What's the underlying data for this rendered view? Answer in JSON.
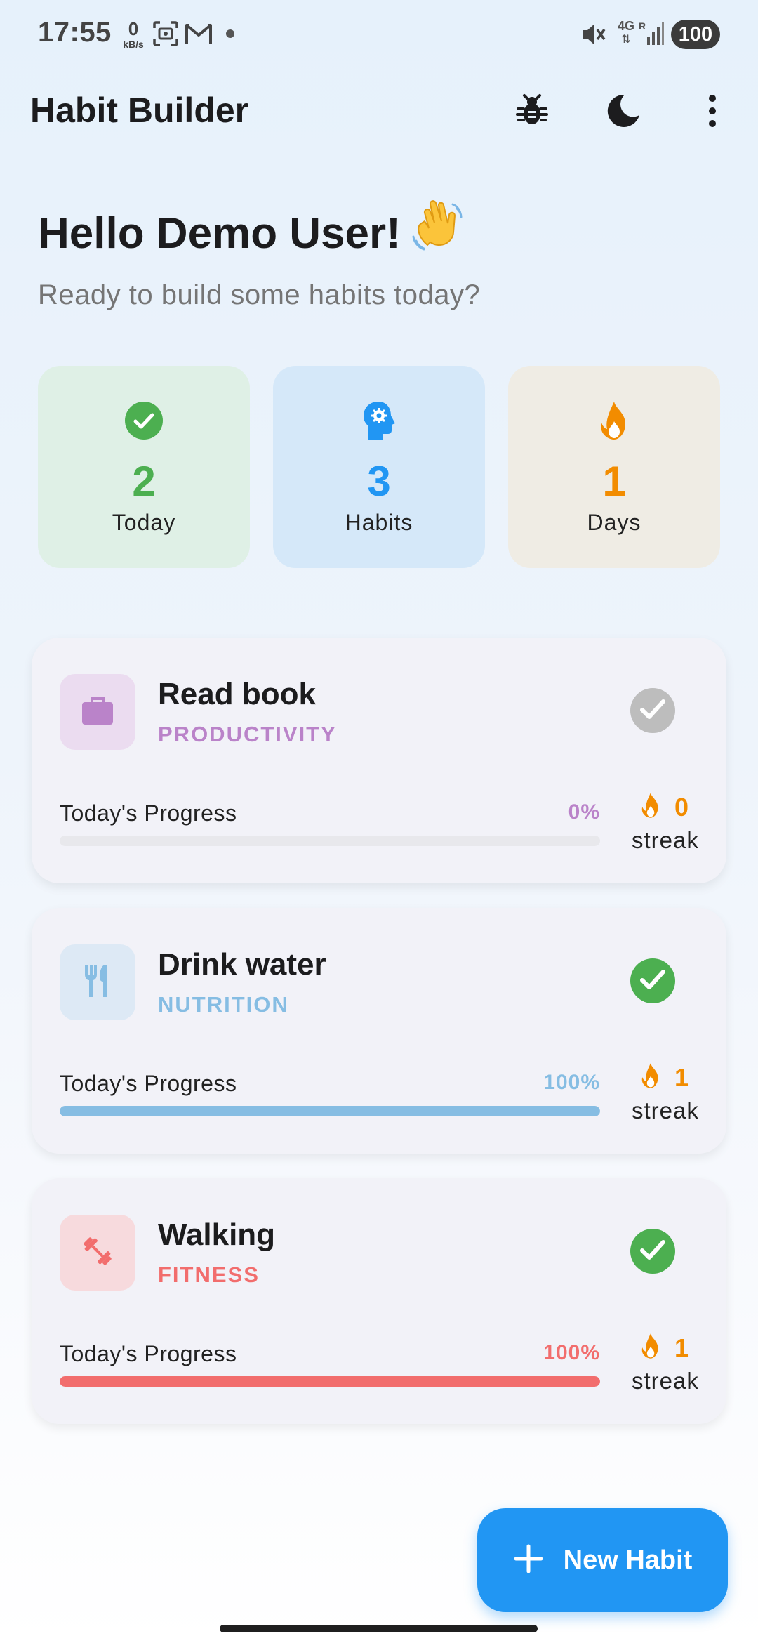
{
  "status_bar": {
    "time": "17:55",
    "speed_value": "0",
    "speed_unit": "kB/s",
    "network": "4G",
    "battery": "100",
    "icons": [
      "screenshot-icon",
      "gmail-icon",
      "mute-icon",
      "signal-icon"
    ]
  },
  "app_bar": {
    "title": "Habit Builder",
    "actions": [
      "bug-icon",
      "dark-mode-icon",
      "more-vert-icon"
    ]
  },
  "greeting": {
    "text": "Hello Demo User!",
    "emoji": "👋",
    "subtitle": "Ready to build some habits today?"
  },
  "stats": [
    {
      "value": "2",
      "label": "Today",
      "icon": "check-circle-icon",
      "color": "#4caf50",
      "bg": "#dff0e6"
    },
    {
      "value": "3",
      "label": "Habits",
      "icon": "psychology-icon",
      "color": "#2196f3",
      "bg": "#d5e8f9"
    },
    {
      "value": "1",
      "label": "Days",
      "icon": "fire-icon",
      "color": "#f28c00",
      "bg": "#efece4"
    }
  ],
  "habits": [
    {
      "name": "Read book",
      "category": "PRODUCTIVITY",
      "icon": "briefcase-icon",
      "color": "#ba83c9",
      "icon_bg": "#ebdcf0",
      "completed": false,
      "progress_label": "Today's Progress",
      "progress_text": "0%",
      "progress": 0,
      "streak": "0",
      "streak_label": "streak"
    },
    {
      "name": "Drink water",
      "category": "NUTRITION",
      "icon": "restaurant-icon",
      "color": "#86bde3",
      "icon_bg": "#dde9f5",
      "completed": true,
      "progress_label": "Today's Progress",
      "progress_text": "100%",
      "progress": 1,
      "streak": "1",
      "streak_label": "streak"
    },
    {
      "name": "Walking",
      "category": "FITNESS",
      "icon": "dumbbell-icon",
      "color": "#f26d6d",
      "icon_bg": "#f7dadd",
      "completed": true,
      "progress_label": "Today's Progress",
      "progress_text": "100%",
      "progress": 1,
      "streak": "1",
      "streak_label": "streak"
    }
  ],
  "fab": {
    "label": "New Habit",
    "icon": "plus-icon"
  },
  "colors": {
    "primary": "#2196f3",
    "success": "#4caf50",
    "streak": "#f28c00",
    "unchecked": "#bdbdbd"
  }
}
